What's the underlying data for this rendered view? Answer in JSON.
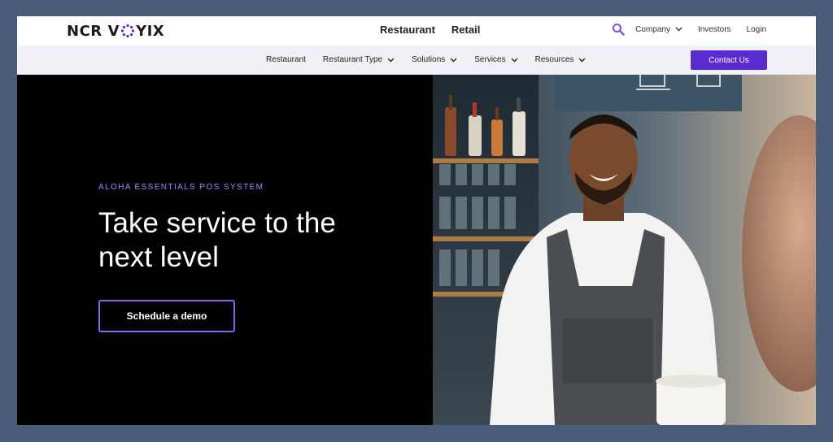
{
  "header": {
    "brand": {
      "left": "NCR",
      "right": "YIX"
    },
    "segments": [
      "Restaurant",
      "Retail"
    ],
    "utility": {
      "company_label": "Company",
      "investors_label": "Investors",
      "login_label": "Login"
    }
  },
  "subnav": {
    "items": [
      {
        "label": "Restaurant",
        "dropdown": false
      },
      {
        "label": "Restaurant Type",
        "dropdown": true
      },
      {
        "label": "Solutions",
        "dropdown": true
      },
      {
        "label": "Services",
        "dropdown": true
      },
      {
        "label": "Resources",
        "dropdown": true
      }
    ],
    "contact_label": "Contact Us"
  },
  "hero": {
    "eyebrow": "ALOHA ESSENTIALS POS SYSTEM",
    "headline": "Take service to the next level",
    "cta_label": "Schedule a demo"
  },
  "colors": {
    "accent": "#5a2bd0",
    "eyebrow": "#a784f0",
    "frame": "#4a5d78"
  },
  "icons": [
    "search-icon",
    "chevron-down-icon"
  ]
}
